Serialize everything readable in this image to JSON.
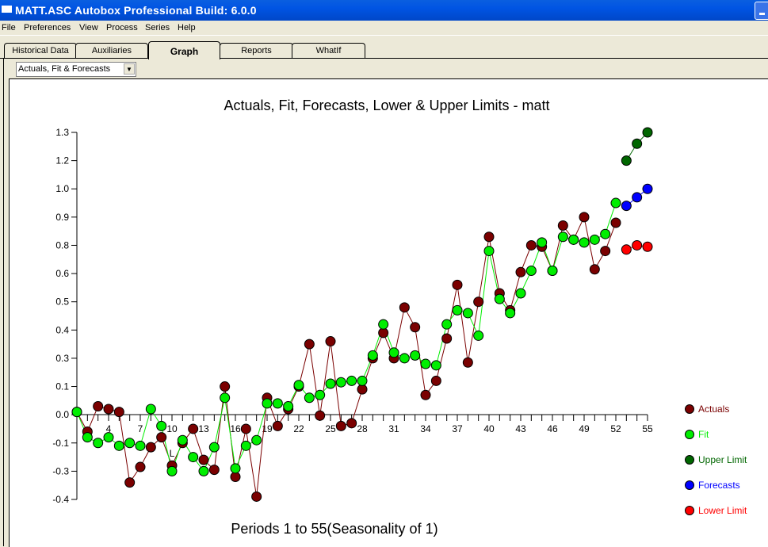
{
  "window": {
    "title": "MATT.ASC  Autobox Professional Build: 6.0.0"
  },
  "menu": [
    "File",
    "Preferences",
    "View",
    "Process",
    "Series",
    "Help"
  ],
  "tabs": [
    {
      "label": "Historical Data",
      "active": false
    },
    {
      "label": "Auxiliaries",
      "active": false
    },
    {
      "label": "Graph",
      "active": true
    },
    {
      "label": "Reports",
      "active": false
    },
    {
      "label": "WhatIf",
      "active": false
    }
  ],
  "graph_select": {
    "value": "Actuals, Fit & Forecasts"
  },
  "colors": {
    "actuals": "#7a0000",
    "fit": "#00ee00",
    "upper": "#006600",
    "forecasts": "#0000ff",
    "lower": "#ff0000"
  },
  "chart_data": {
    "type": "line",
    "title": "Actuals, Fit, Forecasts, Lower & Upper Limits - matt",
    "xlabel": "Periods 1 to 55(Seasonality of 1)",
    "ylabel": "",
    "x_range": [
      1,
      55
    ],
    "x_ticks": [
      4,
      7,
      10,
      13,
      16,
      19,
      22,
      25,
      28,
      31,
      34,
      37,
      40,
      43,
      46,
      49,
      52,
      55
    ],
    "y_tick_labels": [
      "1.3",
      "1.2",
      "1.0",
      "0.9",
      "0.8",
      "0.6",
      "0.5",
      "0.4",
      "0.3",
      "0.1",
      "0.0",
      "-0.1",
      "-0.3",
      "-0.4"
    ],
    "grid": false,
    "legend_position": "right",
    "annotations": [
      "L"
    ],
    "series": [
      {
        "name": "Actuals",
        "x_start": 1,
        "values": [
          0.01,
          -0.06,
          0.03,
          0.02,
          0.01,
          -0.34,
          -0.27,
          -0.13,
          -0.08,
          -0.26,
          -0.1,
          -0.05,
          -0.22,
          -0.29,
          0.1,
          -0.32,
          -0.05,
          -0.39,
          0.06,
          -0.04,
          0.02,
          0.1,
          0.35,
          -0.003,
          0.36,
          -0.04,
          -0.03,
          0.09,
          0.3,
          0.39,
          0.3,
          0.48,
          0.41,
          0.07,
          0.14,
          0.37,
          0.56,
          0.27,
          0.5,
          0.83,
          0.53,
          0.47,
          0.61,
          0.8,
          0.79,
          0.62,
          0.87,
          0.82,
          0.9,
          0.63,
          0.76,
          0.88
        ]
      },
      {
        "name": "Fit",
        "x_start": 1,
        "values": [
          0.01,
          -0.08,
          -0.1,
          -0.08,
          -0.12,
          -0.1,
          -0.12,
          0.02,
          -0.04,
          -0.3,
          -0.09,
          -0.2,
          -0.3,
          -0.13,
          0.06,
          -0.28,
          -0.12,
          -0.09,
          0.04,
          0.04,
          0.03,
          0.11,
          0.06,
          0.07,
          0.12,
          0.13,
          0.14,
          0.14,
          0.31,
          0.42,
          0.32,
          0.3,
          0.31,
          0.26,
          0.25,
          0.42,
          0.47,
          0.46,
          0.38,
          0.76,
          0.51,
          0.46,
          0.53,
          0.62,
          0.81,
          0.62,
          0.83,
          0.82,
          0.81,
          0.82,
          0.84,
          0.95
        ]
      },
      {
        "name": "Upper Limit",
        "x_start": 53,
        "values": [
          1.2,
          1.26,
          1.3
        ]
      },
      {
        "name": "Forecasts",
        "x_start": 53,
        "values": [
          0.94,
          0.97,
          1.0
        ]
      },
      {
        "name": "Lower Limit",
        "x_start": 53,
        "values": [
          0.77,
          0.8,
          0.79
        ]
      }
    ]
  }
}
